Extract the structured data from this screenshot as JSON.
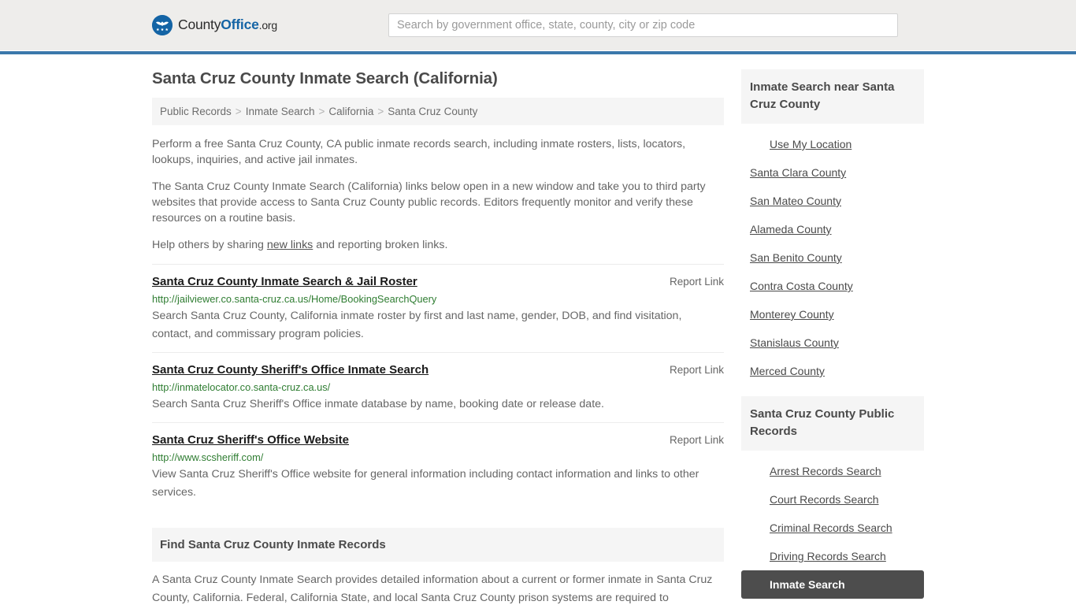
{
  "header": {
    "logo": {
      "icon": "eagle-shield-icon",
      "text_county": "County",
      "text_office": "Office",
      "text_org": ".org"
    },
    "search": {
      "placeholder": "Search by government office, state, county, city or zip code",
      "value": ""
    }
  },
  "main": {
    "title": "Santa Cruz County Inmate Search (California)",
    "breadcrumb": {
      "separator": ">",
      "items": [
        {
          "label": "Public Records",
          "current": false
        },
        {
          "label": "Inmate Search",
          "current": false
        },
        {
          "label": "California",
          "current": false
        },
        {
          "label": "Santa Cruz County",
          "current": true
        }
      ]
    },
    "intro": [
      "Perform a free Santa Cruz County, CA public inmate records search, including inmate rosters, lists, locators, lookups, inquiries, and active jail inmates.",
      "The Santa Cruz County Inmate Search (California) links below open in a new window and take you to third party websites that provide access to Santa Cruz County public records. Editors frequently monitor and verify these resources on a routine basis."
    ],
    "help_line": {
      "before": "Help others by sharing ",
      "link": "new links",
      "after": " and reporting broken links."
    },
    "report_link_label": "Report Link",
    "results": [
      {
        "title": "Santa Cruz County Inmate Search & Jail Roster",
        "url": "http://jailviewer.co.santa-cruz.ca.us/Home/BookingSearchQuery",
        "description": "Search Santa Cruz County, California inmate roster by first and last name, gender, DOB, and find visitation, contact, and commissary program policies."
      },
      {
        "title": "Santa Cruz County Sheriff's Office Inmate Search",
        "url": "http://inmatelocator.co.santa-cruz.ca.us/",
        "description": "Search Santa Cruz Sheriff's Office inmate database by name, booking date or release date."
      },
      {
        "title": "Santa Cruz Sheriff's Office Website",
        "url": "http://www.scsheriff.com/",
        "description": "View Santa Cruz Sheriff's Office website for general information including contact information and links to other services."
      }
    ],
    "find_section": {
      "heading": "Find Santa Cruz County Inmate Records",
      "body": "A Santa Cruz County Inmate Search provides detailed information about a current or former inmate in Santa Cruz County, California. Federal, California State, and local Santa Cruz County prison systems are required to"
    }
  },
  "sidebar": {
    "near_card": {
      "heading": "Inmate Search near Santa Cruz County",
      "items": [
        {
          "label": "Use My Location",
          "indent": true,
          "active": false
        },
        {
          "label": "Santa Clara County",
          "indent": false,
          "active": false
        },
        {
          "label": "San Mateo County",
          "indent": false,
          "active": false
        },
        {
          "label": "Alameda County",
          "indent": false,
          "active": false
        },
        {
          "label": "San Benito County",
          "indent": false,
          "active": false
        },
        {
          "label": "Contra Costa County",
          "indent": false,
          "active": false
        },
        {
          "label": "Monterey County",
          "indent": false,
          "active": false
        },
        {
          "label": "Stanislaus County",
          "indent": false,
          "active": false
        },
        {
          "label": "Merced County",
          "indent": false,
          "active": false
        }
      ]
    },
    "records_card": {
      "heading": "Santa Cruz County Public Records",
      "items": [
        {
          "label": "Arrest Records Search",
          "indent": true,
          "active": false
        },
        {
          "label": "Court Records Search",
          "indent": true,
          "active": false
        },
        {
          "label": "Criminal Records Search",
          "indent": true,
          "active": false
        },
        {
          "label": "Driving Records Search",
          "indent": true,
          "active": false
        },
        {
          "label": "Inmate Search",
          "indent": true,
          "active": true
        }
      ]
    }
  },
  "colors": {
    "brand_blue": "#1464a5",
    "header_rule": "#3b78ab",
    "header_bg": "#eeedeb",
    "panel_bg": "#f5f5f5",
    "url_green": "#2f7d32",
    "active_bg": "#4d4d4d"
  }
}
